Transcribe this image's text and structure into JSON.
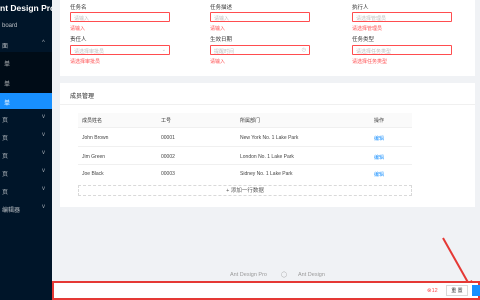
{
  "app": {
    "brand": "nt Design Pro"
  },
  "sidebar": {
    "items": [
      {
        "label": "board",
        "chevron": ""
      },
      {
        "label": "面",
        "chevron": "^"
      },
      {
        "label": "单",
        "chevron": ""
      },
      {
        "label": "单",
        "chevron": ""
      },
      {
        "label": "单",
        "chevron": ""
      },
      {
        "label": "页",
        "chevron": "v"
      },
      {
        "label": "页",
        "chevron": "v"
      },
      {
        "label": "页",
        "chevron": "v"
      },
      {
        "label": "页",
        "chevron": "v"
      },
      {
        "label": "页",
        "chevron": "v"
      },
      {
        "label": "编辑器",
        "chevron": "v"
      }
    ]
  },
  "form": {
    "task_name": {
      "label": "任务名",
      "placeholder": "请输入",
      "error": "请输入"
    },
    "task_desc": {
      "label": "任务描述",
      "placeholder": "请输入",
      "error": "请输入"
    },
    "executor": {
      "label": "执行人",
      "placeholder": "请选择管理员",
      "error": "请选择管理员"
    },
    "owner": {
      "label": "责任人",
      "placeholder": "请选择审批员",
      "error": "请选择审批员"
    },
    "deadline": {
      "label": "生效日期",
      "placeholder": "提醒时间",
      "error": "请输入"
    },
    "task_type": {
      "label": "任务类型",
      "placeholder": "请选择任务类型",
      "error": "请选择任务类型"
    }
  },
  "members": {
    "title": "成员管理",
    "headers": [
      "成员姓名",
      "工号",
      "所属部门",
      "操作"
    ],
    "rows": [
      {
        "name": "John Brown",
        "id": "00001",
        "dept": "New York No. 1 Lake Park",
        "action": "编辑"
      },
      {
        "name": "Jim Green",
        "id": "00002",
        "dept": "London No. 1 Lake Park",
        "action": "编辑"
      },
      {
        "name": "Joe Black",
        "id": "00003",
        "dept": "Sidney No. 1 Lake Park",
        "action": "编辑"
      }
    ],
    "add_row": "+ 添加一行数据"
  },
  "footer": {
    "link1": "Ant Design Pro",
    "link3": "Ant Design"
  },
  "bottom_bar": {
    "error_count": "⊗12",
    "reset": "重 置"
  },
  "colors": {
    "primary": "#1890ff",
    "error": "#ff4d4f",
    "sider": "#001529"
  }
}
